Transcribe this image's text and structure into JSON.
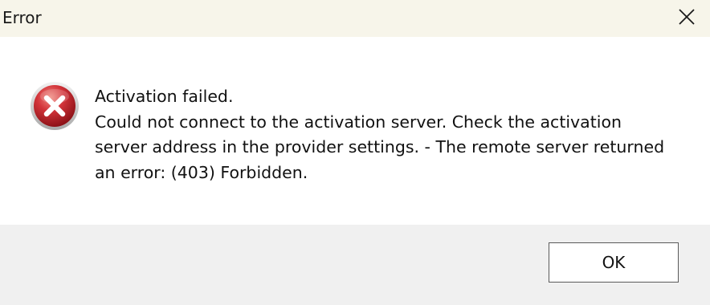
{
  "window": {
    "title": "Error",
    "close_icon": "close-icon"
  },
  "dialog": {
    "icon": "error-icon",
    "message_lines": [
      "Activation failed.",
      "Could not connect to the activation server. Check the activation",
      "server address in the provider settings. - The remote server returned",
      "an error: (403) Forbidden."
    ]
  },
  "buttons": {
    "ok_label": "OK"
  },
  "colors": {
    "titlebar": "#f7f5ea",
    "content": "#ffffff",
    "footer": "#f0f0f0",
    "error_red": "#c1272d"
  }
}
